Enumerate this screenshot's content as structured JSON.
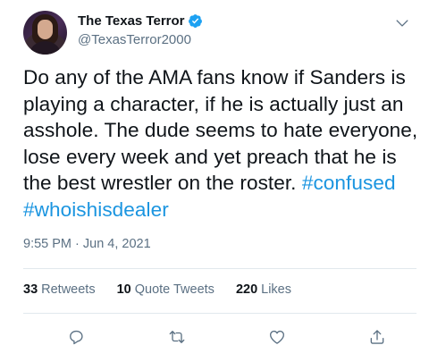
{
  "tweet": {
    "author": {
      "display_name": "The Texas Terror",
      "handle": "@TexasTerror2000",
      "verified": true
    },
    "text_plain": "Do any of the AMA fans know if Sanders is playing a character, if he is actually just an asshole. The dude seems to hate everyone, lose every week and yet preach that he is the best wrestler on the roster. ",
    "hashtags": [
      "#confused",
      "#whoishisdealer"
    ],
    "timestamp": "9:55 PM · Jun 4, 2021",
    "stats": {
      "retweets": {
        "count": "33",
        "label": "Retweets"
      },
      "quote_tweets": {
        "count": "10",
        "label": "Quote Tweets"
      },
      "likes": {
        "count": "220",
        "label": "Likes"
      }
    }
  },
  "icons": {
    "menu": "chevron-down-icon",
    "reply": "reply-icon",
    "retweet": "retweet-icon",
    "like": "heart-icon",
    "share": "share-icon",
    "verified": "verified-badge-icon"
  },
  "colors": {
    "accent": "#1b95e0",
    "verified": "#1da1f2",
    "text_primary": "#0f1419",
    "text_secondary": "#5b7083",
    "divider": "#e1e8ed"
  }
}
